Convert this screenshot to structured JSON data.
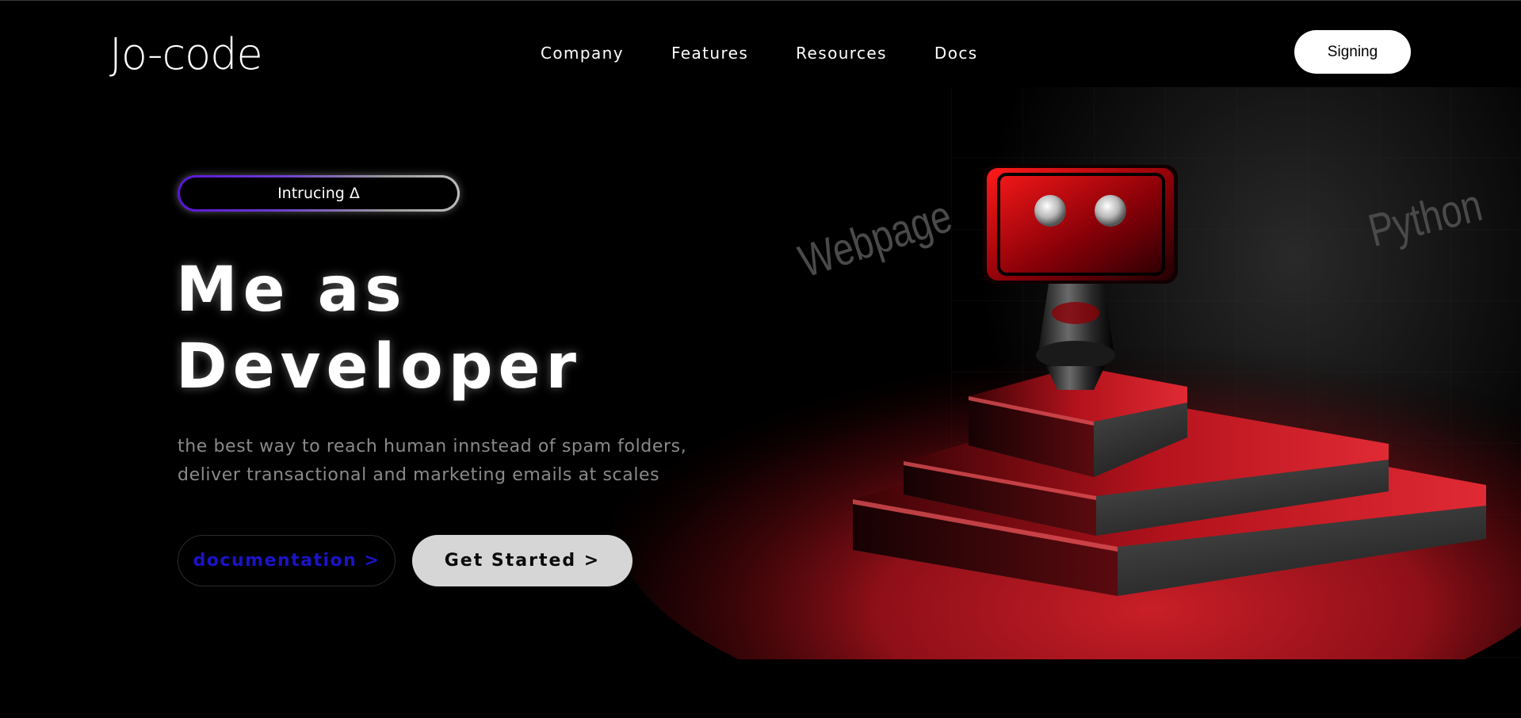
{
  "header": {
    "logo": "Jo-code",
    "nav": [
      "Company",
      "Features",
      "Resources",
      "Docs"
    ],
    "signin_label": "Signing"
  },
  "hero": {
    "badge": "Intrucing Δ",
    "headline_line1": "Me as",
    "headline_line2": "Developer",
    "subtext_line1": "the best way to reach human innstead of spam folders,",
    "subtext_line2": "deliver transactional and marketing emails at scales",
    "doc_button": "documentation >",
    "start_button": "Get Started >"
  },
  "scene": {
    "words": [
      "Webpage",
      "Python"
    ],
    "image": "red-robot-on-stepped-pedestal",
    "accent_color": "#c0121c",
    "doc_link_color": "#1a14c8"
  }
}
